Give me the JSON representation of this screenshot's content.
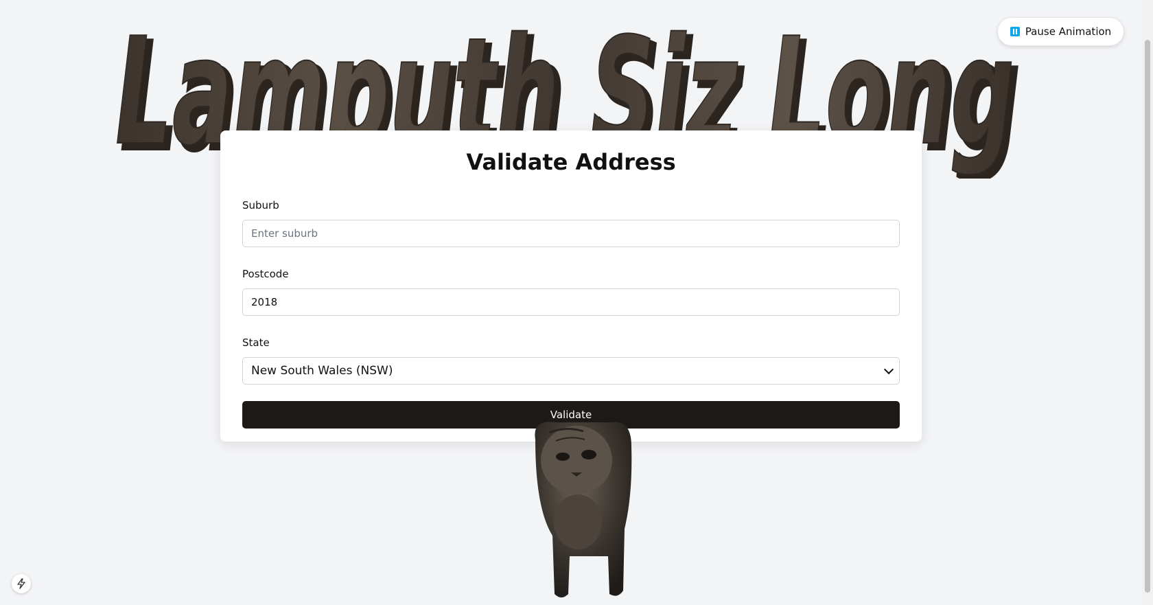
{
  "banner": {
    "text_3d": "Lamputh Siz Long",
    "wood_color": "#4a4038"
  },
  "animation_control": {
    "label": "Pause Animation",
    "icon": "pause-icon",
    "accent": "#0ea5e9"
  },
  "form": {
    "title": "Validate Address",
    "suburb": {
      "label": "Suburb",
      "placeholder": "Enter suburb",
      "value": ""
    },
    "postcode": {
      "label": "Postcode",
      "placeholder": "",
      "value": "2018"
    },
    "state": {
      "label": "State",
      "selected": "New South Wales (NSW)"
    },
    "submit_label": "Validate",
    "submit_color": "#1c1917"
  },
  "floating": {
    "bolt_icon": "bolt-icon"
  }
}
